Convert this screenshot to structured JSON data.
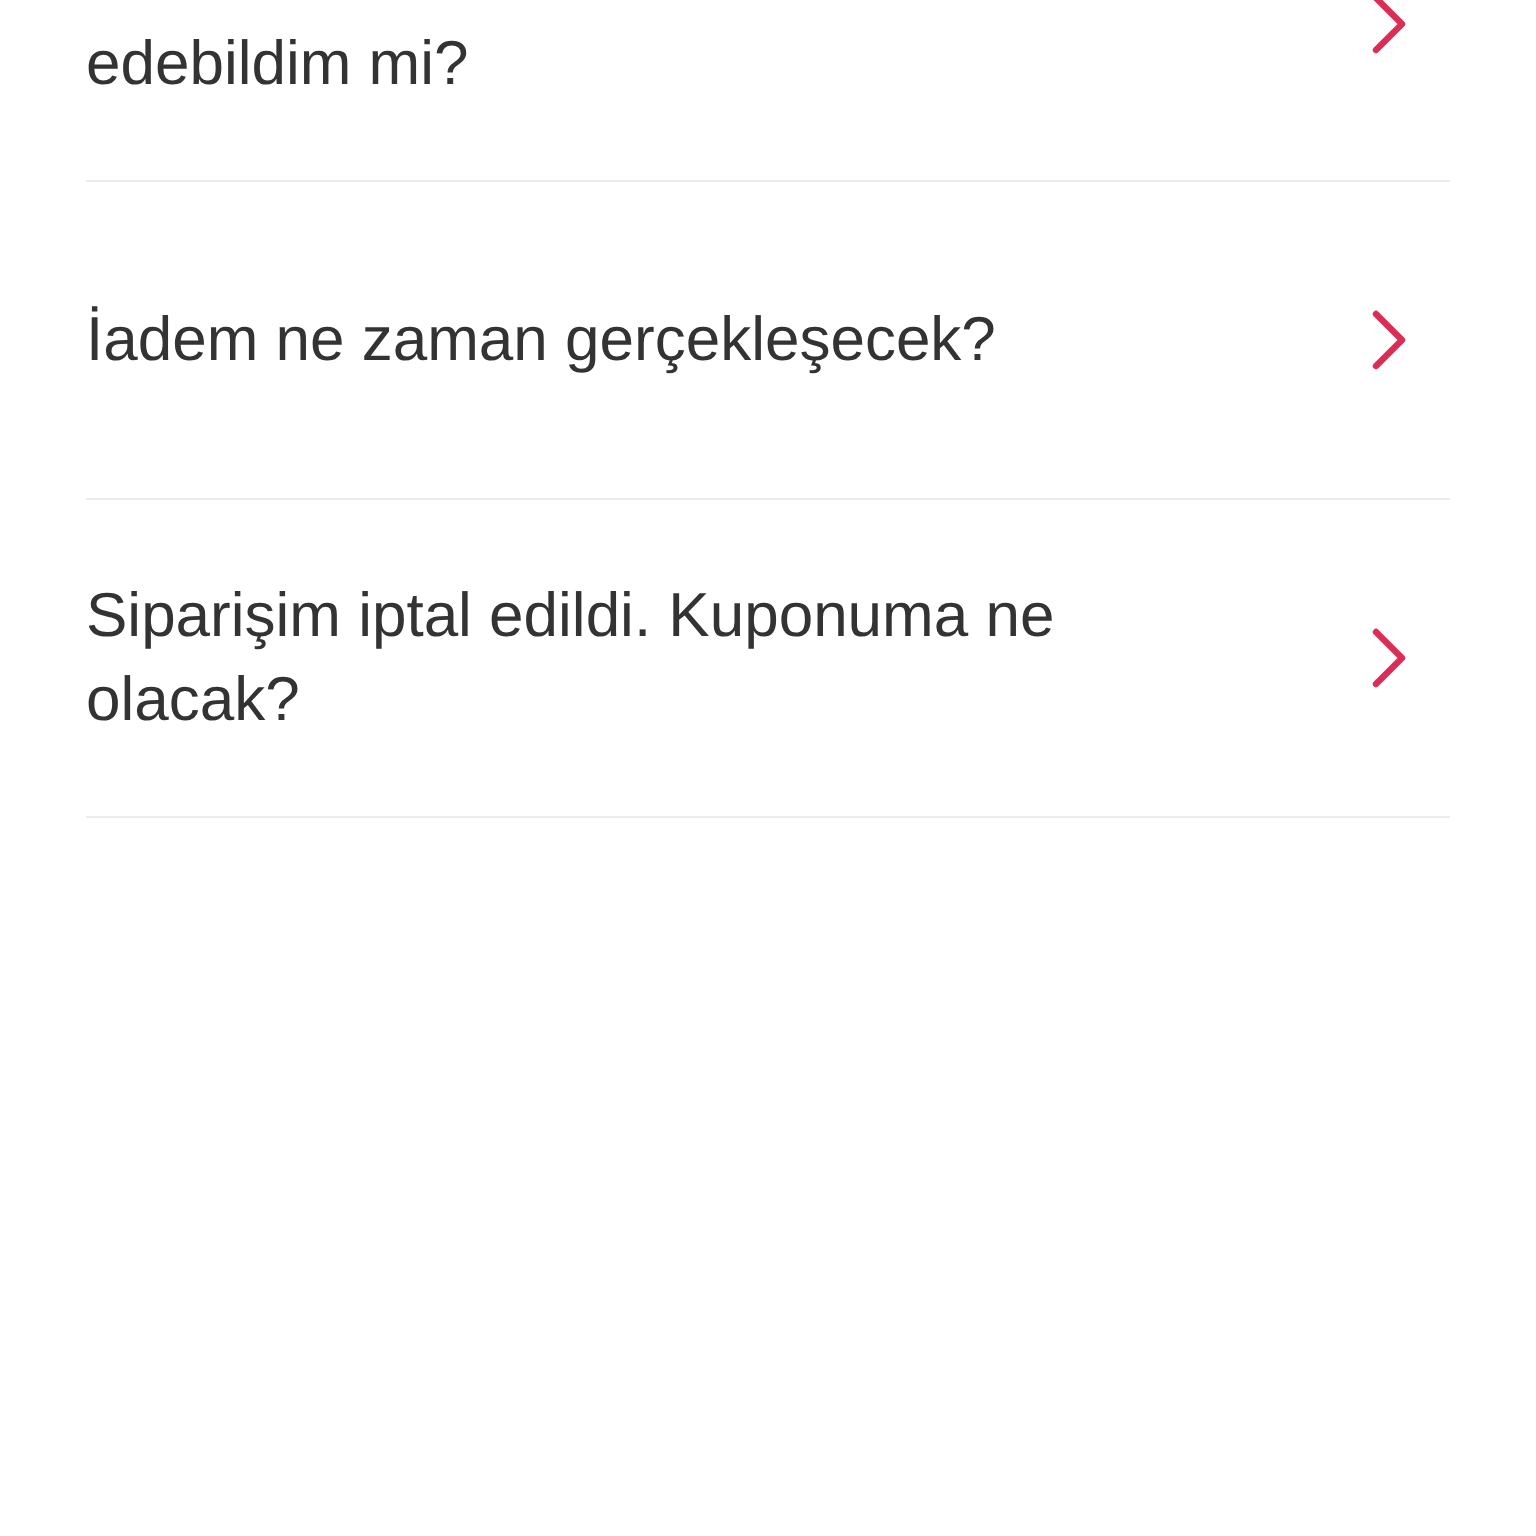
{
  "faq_items": [
    {
      "question": "edebildim mi?",
      "kind": "cut"
    },
    {
      "question": "İadem ne zaman gerçekleşecek?",
      "kind": "full"
    },
    {
      "question": "Siparişim iptal edildi. Kuponuma ne olacak?",
      "kind": "full"
    }
  ]
}
